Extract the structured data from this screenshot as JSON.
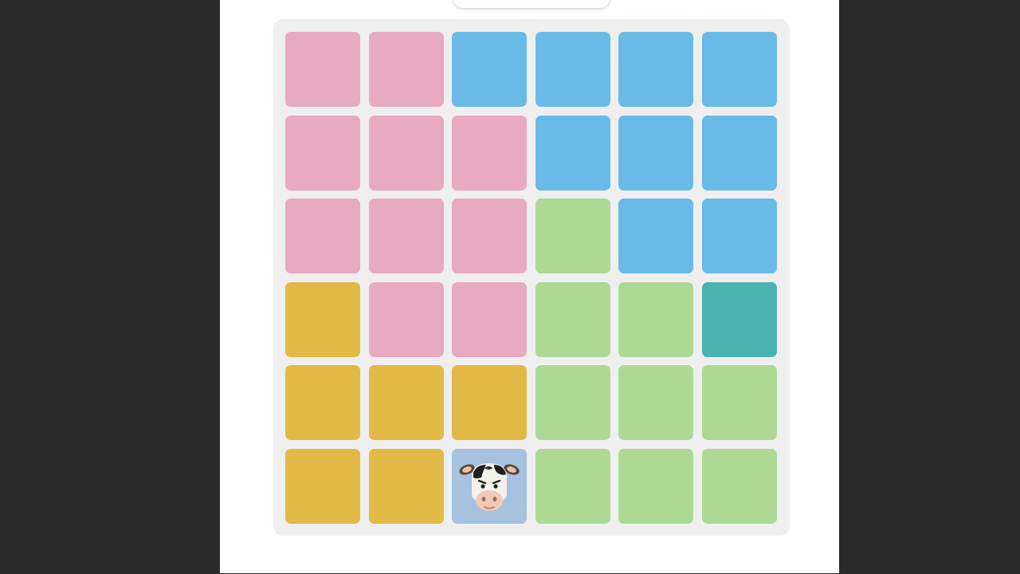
{
  "palette": {
    "pink": "#e8aac1",
    "blue": "#69bae6",
    "green": "#add995",
    "yellow": "#e2b945",
    "teal": "#4ab3b1",
    "slate": "#a7c2e0"
  },
  "board": {
    "rows": 6,
    "cols": 6,
    "grid": [
      [
        "pink",
        "pink",
        "blue",
        "blue",
        "blue",
        "blue"
      ],
      [
        "pink",
        "pink",
        "pink",
        "blue",
        "blue",
        "blue"
      ],
      [
        "pink",
        "pink",
        "pink",
        "green",
        "blue",
        "blue"
      ],
      [
        "yellow",
        "pink",
        "pink",
        "green",
        "green",
        "teal"
      ],
      [
        "yellow",
        "yellow",
        "yellow",
        "green",
        "green",
        "green"
      ],
      [
        "yellow",
        "yellow",
        "slate",
        "green",
        "green",
        "green"
      ]
    ],
    "pieces": [
      {
        "row": 5,
        "col": 2,
        "icon": "cow-face-icon"
      }
    ]
  }
}
